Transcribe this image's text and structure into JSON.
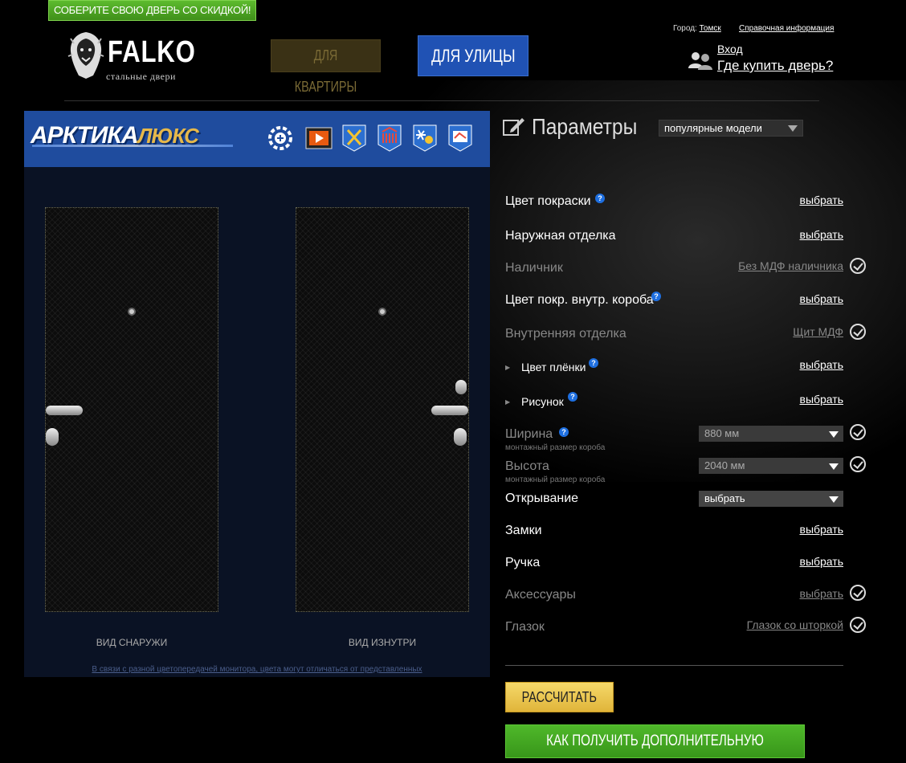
{
  "promo": {
    "label": "СОБЕРИТЕ СВОЮ ДВЕРЬ СО СКИДКОЙ!"
  },
  "logo": {
    "brand": "FALKO",
    "tagline": "стальные двери"
  },
  "nav": {
    "apartment": "ДЛЯ КВАРТИРЫ",
    "street": "ДЛЯ УЛИЦЫ"
  },
  "topbar": {
    "city_label": "Город:",
    "city": "Томск",
    "info": "Справочная информация",
    "login": "Вход",
    "buy": "Где купить дверь?"
  },
  "model": {
    "name_main": "АРКТИКА",
    "name_lux": "ЛЮКС"
  },
  "features": [
    "settings-icon",
    "video-icon",
    "tools-icon",
    "radiator-icon",
    "snowflake-sun-icon",
    "certificate-icon"
  ],
  "views": {
    "outside": "ВИД СНАРУЖИ",
    "inside": "ВИД ИЗНУТРИ"
  },
  "disclaimer": "В связи с разной цветопередачей монитора, цвета могут отличаться от представленных",
  "params": {
    "title": "Параметры",
    "preset": "популярные модели",
    "rows": [
      {
        "label": "Цвет покраски",
        "value": "выбрать"
      },
      {
        "label": "Наружная отделка",
        "value": "выбрать"
      },
      {
        "label": "Наличник",
        "value": "Без МДФ наличника"
      },
      {
        "label": "Цвет покр. внутр. короба",
        "value": "выбрать"
      },
      {
        "label": "Внутренняя отделка",
        "value": "Щит МДФ"
      },
      {
        "label": "Цвет плёнки",
        "value": "выбрать"
      },
      {
        "label": "Рисунок",
        "value": "выбрать"
      },
      {
        "label": "Ширина",
        "sub": "монтажный размер короба",
        "value": "880 мм"
      },
      {
        "label": "Высота",
        "sub": "монтажный размер короба",
        "value": "2040 мм"
      },
      {
        "label": "Открывание",
        "value": "выбрать"
      },
      {
        "label": "Замки",
        "value": "выбрать"
      },
      {
        "label": "Ручка",
        "value": "выбрать"
      },
      {
        "label": "Аксессуары",
        "value": "выбрать"
      },
      {
        "label": "Глазок",
        "value": "Глазок со шторкой"
      }
    ]
  },
  "actions": {
    "calculate": "РАССЧИТАТЬ",
    "discount": "КАК ПОЛУЧИТЬ ДОПОЛНИТЕЛЬНУЮ СКИДКУ?"
  }
}
